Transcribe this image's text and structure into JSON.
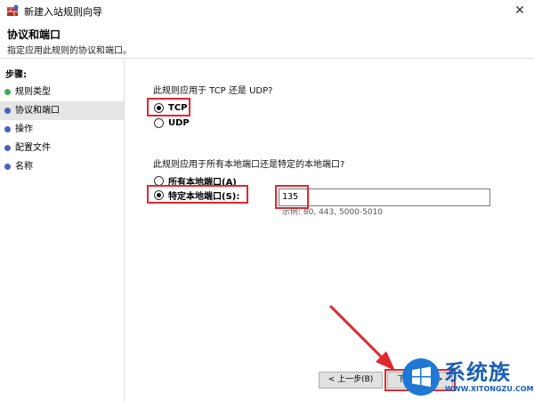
{
  "window": {
    "title": "新建入站规则向导",
    "app_icon": "firewall-icon",
    "close_glyph": "✕"
  },
  "header": {
    "title": "协议和端口",
    "subtitle": "指定应用此规则的协议和端口。"
  },
  "sidebar": {
    "steps_label": "步骤:",
    "items": [
      {
        "label": "规则类型",
        "state": "done"
      },
      {
        "label": "协议和端口",
        "state": "current"
      },
      {
        "label": "操作",
        "state": "pending"
      },
      {
        "label": "配置文件",
        "state": "pending"
      },
      {
        "label": "名称",
        "state": "pending"
      }
    ]
  },
  "protocol": {
    "question": "此规则应用于 TCP 还是 UDP?",
    "options": [
      {
        "label": "TCP",
        "checked": true
      },
      {
        "label": "UDP",
        "checked": false
      }
    ]
  },
  "ports": {
    "question": "此规则应用于所有本地端口还是特定的本地端口?",
    "options": [
      {
        "label": "所有本地端口(A)",
        "checked": false
      },
      {
        "label": "特定本地端口(S):",
        "checked": true
      }
    ],
    "value": "135",
    "example": "示例: 80, 443, 5000-5010"
  },
  "buttons": {
    "back": "< 上一步(B)",
    "next": "下一步(N) >"
  },
  "watermark": {
    "text": "系统族",
    "url": "WWW.XITONGZU.COM"
  },
  "colors": {
    "highlight": "#e0282e",
    "done_step": "#3cae4f",
    "pending_step": "#4a62b8",
    "watermark": "#1a5fb4"
  }
}
